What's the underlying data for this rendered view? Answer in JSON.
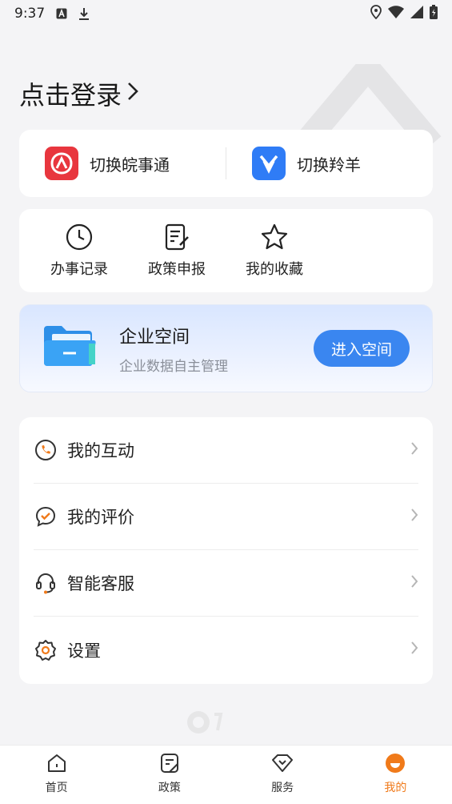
{
  "status_bar": {
    "time": "9:37"
  },
  "login": {
    "label": "点击登录"
  },
  "switch": [
    {
      "label": "切换皖事通",
      "icon": "wanshitong-logo",
      "color": "#e8363e"
    },
    {
      "label": "切换羚羊",
      "icon": "lingyang-logo",
      "color": "#2f7cf6"
    }
  ],
  "quick": [
    {
      "label": "办事记录",
      "icon": "clock-icon"
    },
    {
      "label": "政策申报",
      "icon": "document-edit-icon"
    },
    {
      "label": "我的收藏",
      "icon": "star-icon"
    }
  ],
  "space": {
    "title": "企业空间",
    "subtitle": "企业数据自主管理",
    "button": "进入空间",
    "accent": "#3a86f0"
  },
  "menu": [
    {
      "label": "我的互动",
      "icon": "phone-icon"
    },
    {
      "label": "我的评价",
      "icon": "comment-check-icon"
    },
    {
      "label": "智能客服",
      "icon": "headset-icon"
    },
    {
      "label": "设置",
      "icon": "gear-icon"
    }
  ],
  "tabs": [
    {
      "label": "首页",
      "icon": "home-icon"
    },
    {
      "label": "政策",
      "icon": "policy-icon"
    },
    {
      "label": "服务",
      "icon": "diamond-icon"
    },
    {
      "label": "我的",
      "icon": "profile-icon",
      "active": true
    }
  ],
  "colors": {
    "active_tab": "#f07a1a",
    "menu_icon_accent": "#f07a1a"
  }
}
